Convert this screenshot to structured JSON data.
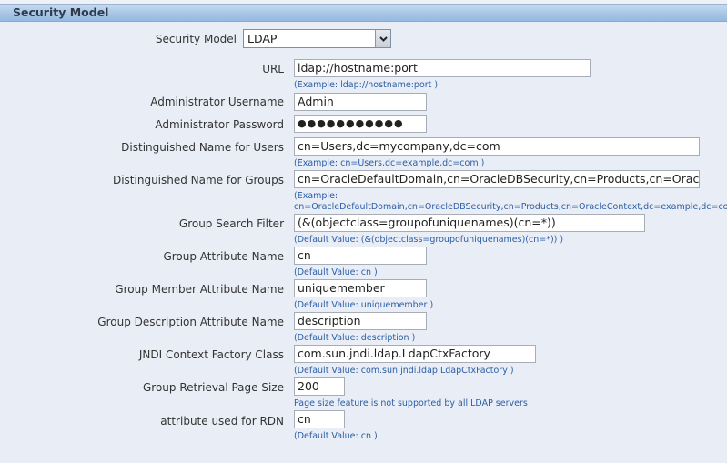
{
  "section": {
    "title": "Security Model"
  },
  "security_model": {
    "label": "Security Model",
    "selected": "LDAP"
  },
  "fields": {
    "url": {
      "label": "URL",
      "value": "ldap://hostname:port",
      "hint": "(Example: ldap://hostname:port )"
    },
    "admin_user": {
      "label": "Administrator Username",
      "value": "Admin"
    },
    "admin_password": {
      "label": "Administrator Password",
      "value": "●●●●●●●●●●●"
    },
    "dn_users": {
      "label": "Distinguished Name for Users",
      "value": "cn=Users,dc=mycompany,dc=com",
      "hint": "(Example: cn=Users,dc=example,dc=com )"
    },
    "dn_groups": {
      "label": "Distinguished Name for Groups",
      "value": "cn=OracleDefaultDomain,cn=OracleDBSecurity,cn=Products,cn=OracleContext",
      "hint_line1": "(Example:",
      "hint_line2": "cn=OracleDefaultDomain,cn=OracleDBSecurity,cn=Products,cn=OracleContext,dc=example,dc=com )"
    },
    "group_search_filter": {
      "label": "Group Search Filter",
      "value": "(&(objectclass=groupofuniquenames)(cn=*))",
      "hint": "(Default Value: (&(objectclass=groupofuniquenames)(cn=*)) )"
    },
    "group_attr_name": {
      "label": "Group Attribute Name",
      "value": "cn",
      "hint": "(Default Value: cn )"
    },
    "group_member_attr": {
      "label": "Group Member Attribute Name",
      "value": "uniquemember",
      "hint": "(Default Value: uniquemember )"
    },
    "group_desc_attr": {
      "label": "Group Description Attribute Name",
      "value": "description",
      "hint": "(Default Value: description )"
    },
    "jndi_factory": {
      "label": "JNDI Context Factory Class",
      "value": "com.sun.jndi.ldap.LdapCtxFactory",
      "hint": "(Default Value: com.sun.jndi.ldap.LdapCtxFactory )"
    },
    "page_size": {
      "label": "Group Retrieval Page Size",
      "value": "200",
      "hint": "Page size feature is not supported by all LDAP servers"
    },
    "rdn_attr": {
      "label": "attribute used for RDN",
      "value": "cn",
      "hint": "(Default Value: cn )"
    }
  }
}
